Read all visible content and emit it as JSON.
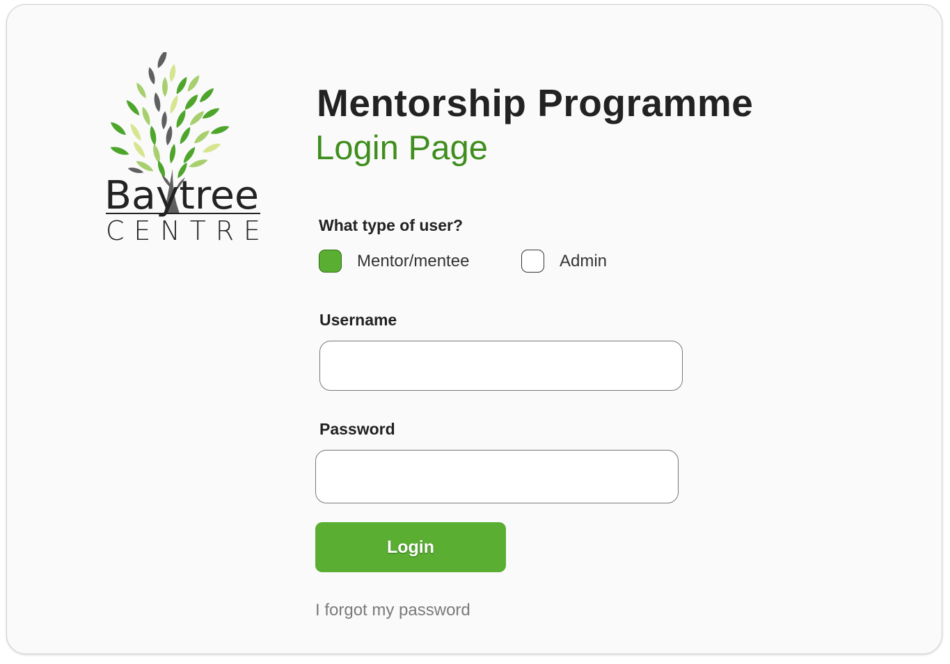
{
  "brand": {
    "logo_word": "Baytree",
    "logo_subword": "CENTRE",
    "colors": {
      "leaf_dark_green": "#4ea52c",
      "leaf_light_green": "#a7cf6e",
      "leaf_lime": "#d6e58f",
      "leaf_grey": "#5f5f5f"
    }
  },
  "header": {
    "title": "Mentorship Programme",
    "subtitle": "Login Page"
  },
  "user_type": {
    "label": "What type of user?",
    "options": [
      {
        "label": "Mentor/mentee",
        "checked": true
      },
      {
        "label": "Admin",
        "checked": false
      }
    ]
  },
  "username": {
    "label": "Username",
    "value": "",
    "placeholder": ""
  },
  "password": {
    "label": "Password",
    "value": "",
    "placeholder": ""
  },
  "login_button": {
    "label": "Login",
    "color": "#5aaf32"
  },
  "forgot_link": {
    "label": "I forgot my password"
  },
  "colors": {
    "accent_green": "#5aaf32",
    "subtitle_green": "#3f8e1e",
    "card_background": "#fafafa",
    "text_dark": "#222222"
  }
}
